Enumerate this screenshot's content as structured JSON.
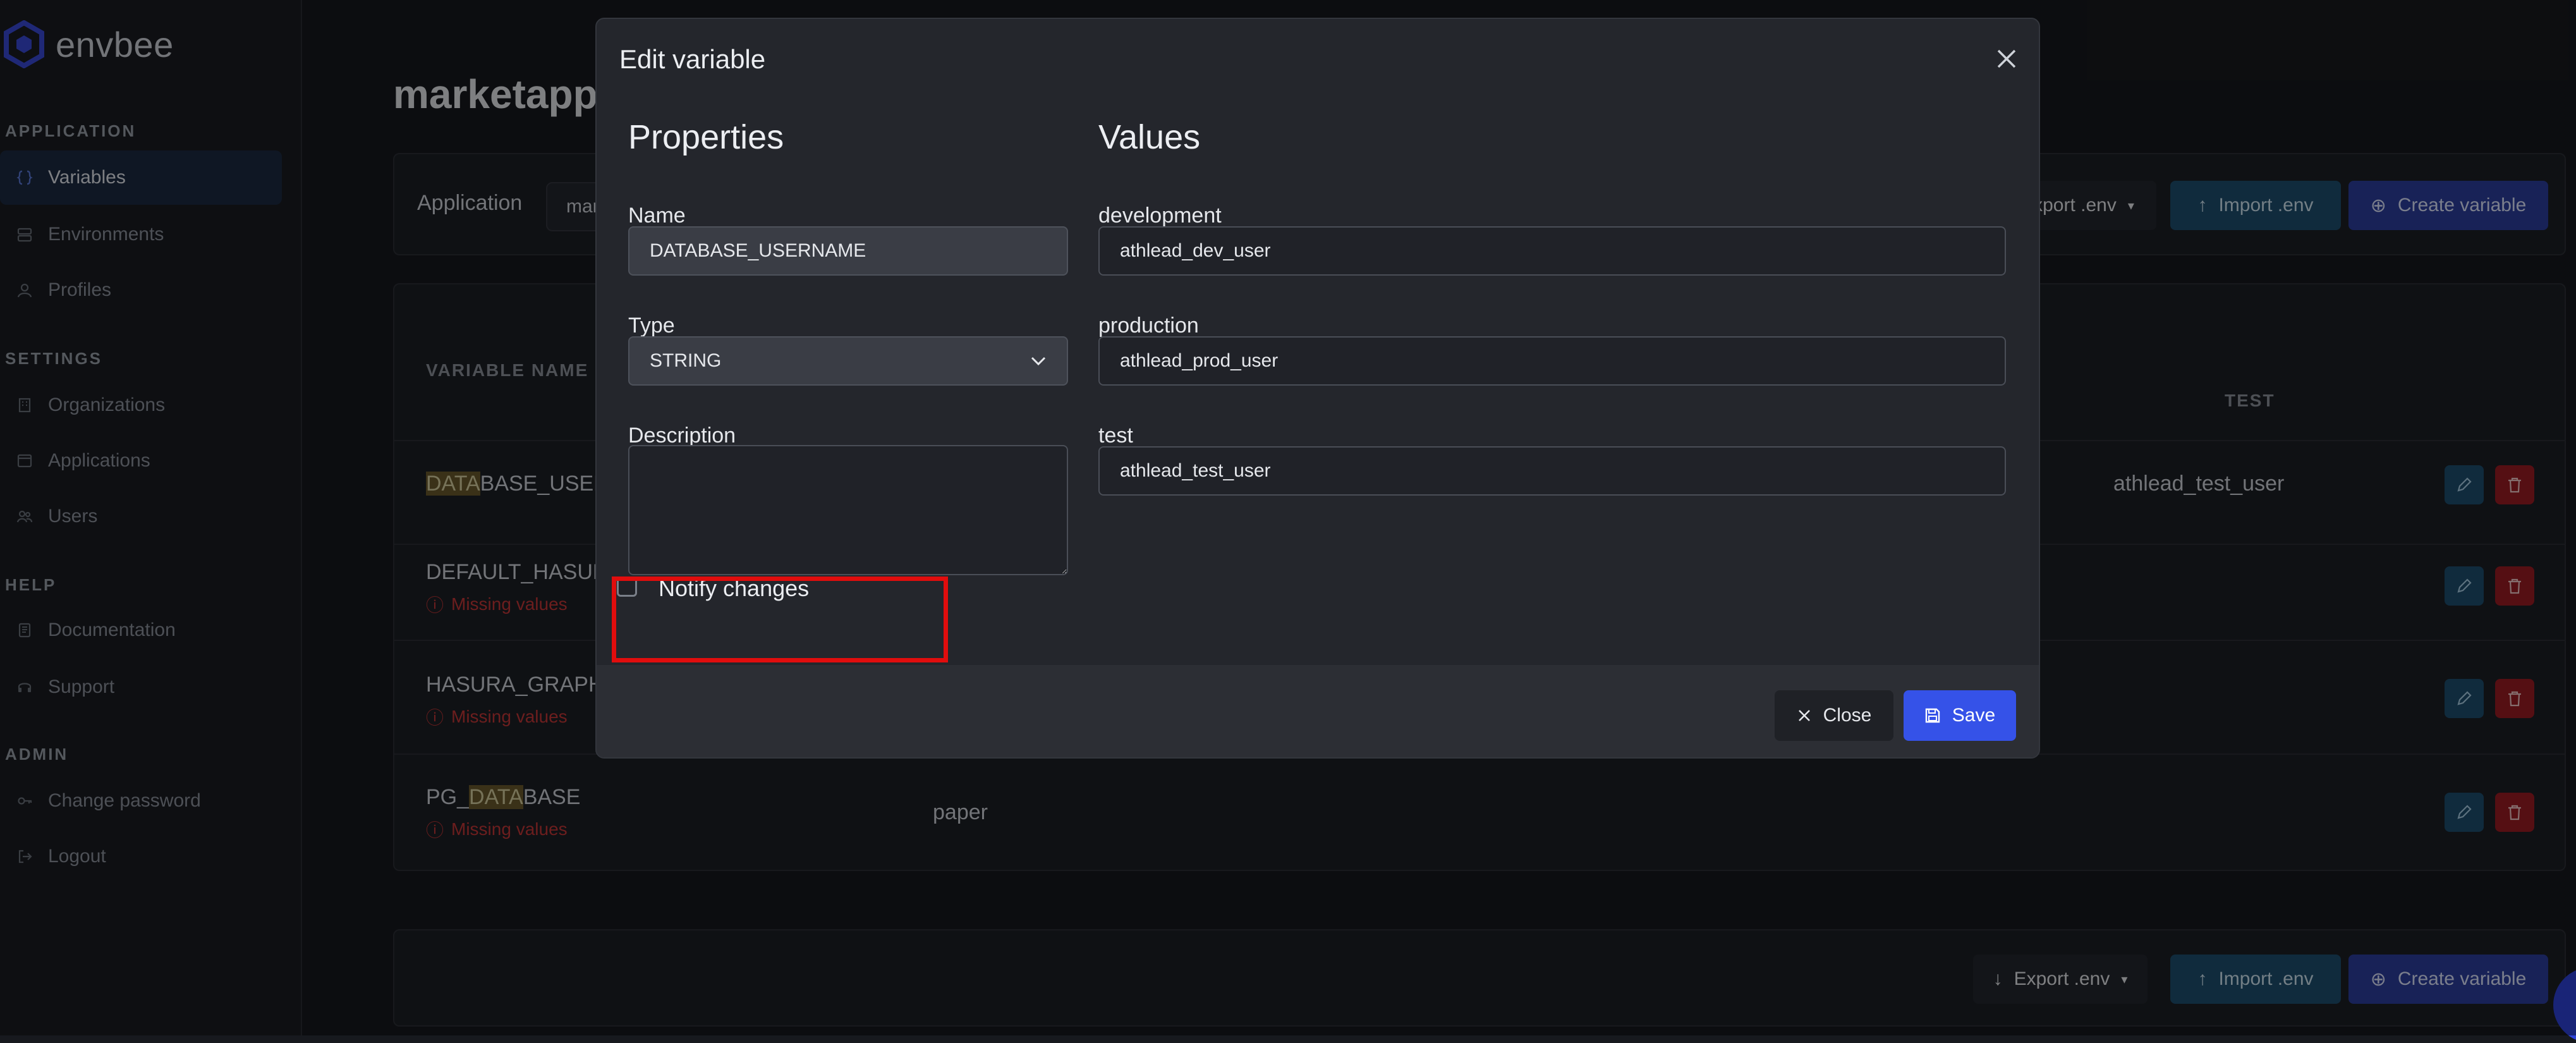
{
  "brand": {
    "name": "envbee"
  },
  "sidebar": {
    "sections": [
      {
        "title": "APPLICATION",
        "items": [
          {
            "label": "Variables",
            "icon": "braces-icon",
            "active": true
          },
          {
            "label": "Environments",
            "icon": "server-icon"
          },
          {
            "label": "Profiles",
            "icon": "user-badge-icon"
          }
        ]
      },
      {
        "title": "SETTINGS",
        "items": [
          {
            "label": "Organizations",
            "icon": "building-icon"
          },
          {
            "label": "Applications",
            "icon": "window-icon"
          },
          {
            "label": "Users",
            "icon": "users-icon"
          }
        ]
      },
      {
        "title": "HELP",
        "items": [
          {
            "label": "Documentation",
            "icon": "book-icon"
          },
          {
            "label": "Support",
            "icon": "headset-icon"
          }
        ]
      },
      {
        "title": "ADMIN",
        "items": [
          {
            "label": "Change password",
            "icon": "key-icon"
          },
          {
            "label": "Logout",
            "icon": "logout-icon"
          }
        ]
      }
    ]
  },
  "page": {
    "title": "marketapp",
    "toolbar": {
      "application_label": "Application",
      "application_value": "mar",
      "export_label": "xport .env",
      "import_label": "Import .env",
      "create_label": "Create variable"
    },
    "table": {
      "col_variable_name": "VARIABLE NAME",
      "col_test": "TEST",
      "rows": [
        {
          "name_highlight": "DATA",
          "name_rest": "BASE_USERN",
          "missing": "",
          "test": "athlead_test_user"
        },
        {
          "name_prefix": "DEFAULT_HASURA",
          "missing": "Missing values"
        },
        {
          "name_prefix": "HASURA_GRAPHQ",
          "missing": "Missing values"
        },
        {
          "name_prefix": "PG_",
          "name_highlight": "DATA",
          "name_rest": "BASE",
          "missing": "Missing values",
          "value": "paper"
        }
      ]
    },
    "bottom_toolbar": {
      "export_label": "Export .env",
      "import_label": "Import .env",
      "create_label": "Create variable"
    }
  },
  "modal": {
    "title": "Edit variable",
    "properties_heading": "Properties",
    "values_heading": "Values",
    "name_label": "Name",
    "name_value": "DATABASE_USERNAME",
    "type_label": "Type",
    "type_value": "STRING",
    "description_label": "Description",
    "description_value": "",
    "notify_label": "Notify changes",
    "notify_checked": false,
    "env_values": [
      {
        "env": "development",
        "value": "athlead_dev_user"
      },
      {
        "env": "production",
        "value": "athlead_prod_user"
      },
      {
        "env": "test",
        "value": "athlead_test_user"
      }
    ],
    "close_label": "Close",
    "save_label": "Save"
  },
  "colors": {
    "accent_blue": "#3552e8",
    "teal_button": "#1e4f6f",
    "danger": "#c53737",
    "annotation": "#e10d0d"
  }
}
